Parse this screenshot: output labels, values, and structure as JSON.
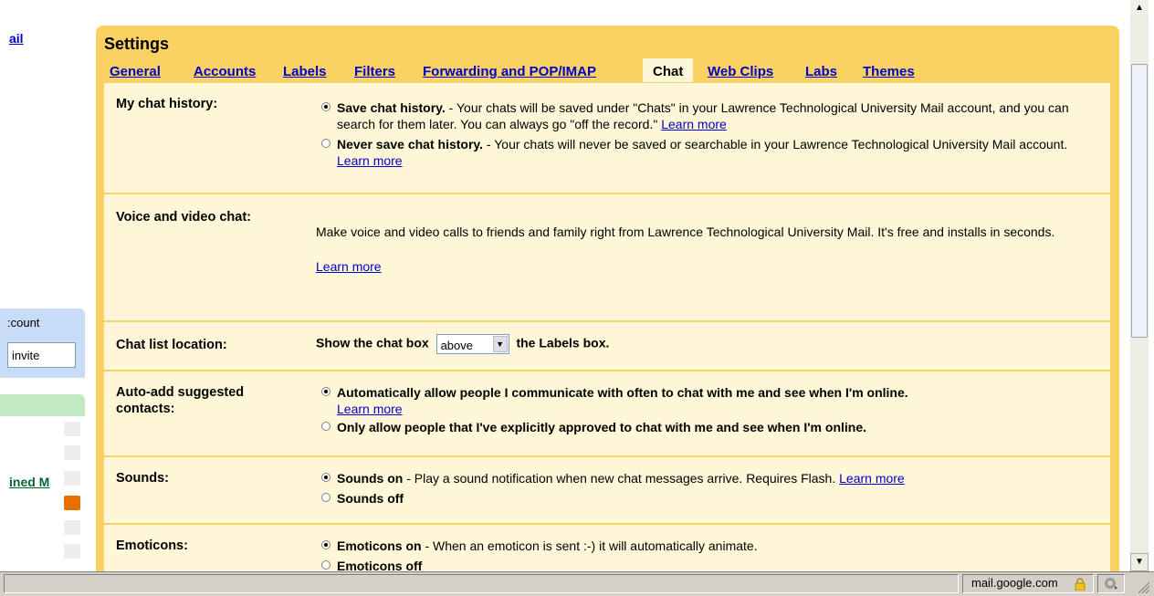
{
  "left_sidebar": {
    "mail_link": "ail",
    "account_label": ":count",
    "invite_value": "invite",
    "label_link": "ined M"
  },
  "settings": {
    "title": "Settings",
    "tabs": [
      {
        "label": "General"
      },
      {
        "label": "Accounts"
      },
      {
        "label": "Labels"
      },
      {
        "label": "Filters"
      },
      {
        "label": "Forwarding and POP/IMAP"
      },
      {
        "label": "Chat"
      },
      {
        "label": "Web Clips"
      },
      {
        "label": "Labs"
      },
      {
        "label": "Themes"
      }
    ],
    "active_tab": "Chat",
    "chat_history": {
      "label": "My chat history:",
      "opt1_bold": "Save chat history.",
      "opt1_text": " - Your chats will be saved under \"Chats\" in your Lawrence Technological University Mail account, and you can search for them later. You can always go \"off the record.\" ",
      "opt1_link": "Learn more",
      "opt2_bold": "Never save chat history.",
      "opt2_text": " - Your chats will never be saved or searchable in your Lawrence Technological University Mail account. ",
      "opt2_link": "Learn more"
    },
    "voice_video": {
      "label": "Voice and video chat:",
      "text": "Make voice and video calls to friends and family right from Lawrence Technological University Mail. It's free and installs in seconds.",
      "link": "Learn more"
    },
    "chat_list": {
      "label": "Chat list location:",
      "before": "Show the chat box",
      "select_value": "above",
      "after": "the Labels box."
    },
    "auto_add": {
      "label": "Auto-add suggested contacts:",
      "opt1": "Automatically allow people I communicate with often to chat with me and see when I'm online.",
      "opt1_link": "Learn more",
      "opt2": "Only allow people that I've explicitly approved to chat with me and see when I'm online."
    },
    "sounds": {
      "label": "Sounds:",
      "opt1_bold": "Sounds on",
      "opt1_text": " - Play a sound notification when new chat messages arrive. Requires Flash. ",
      "opt1_link": "Learn more",
      "opt2_bold": "Sounds off"
    },
    "emoticons": {
      "label": "Emoticons:",
      "opt1_bold": "Emoticons on",
      "opt1_text": " - When an emoticon is sent :-) it will automatically animate.",
      "opt2_bold": "Emoticons off"
    }
  },
  "status_bar": {
    "url": "mail.google.com"
  },
  "colors": {
    "panel": "#fad163",
    "body": "#fff7d7",
    "link": "#0000cc"
  }
}
